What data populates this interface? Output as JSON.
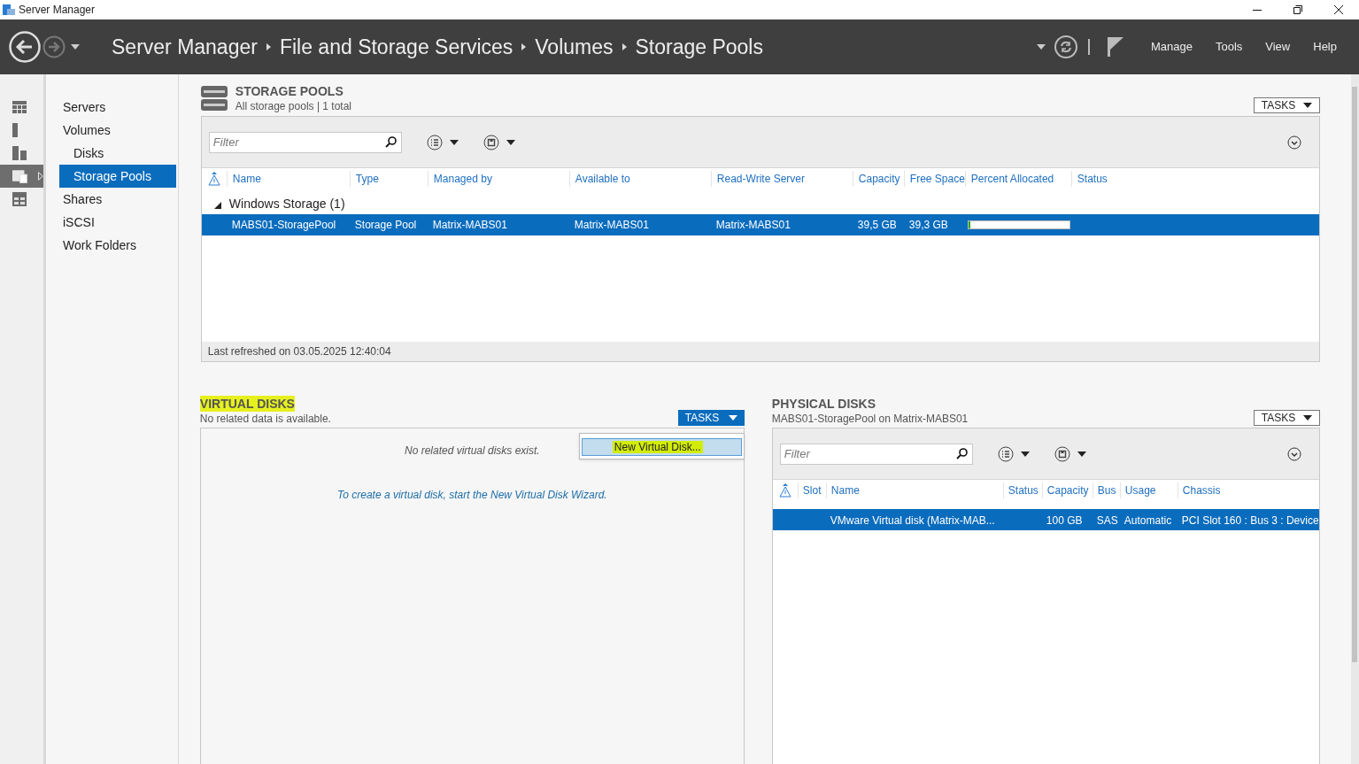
{
  "window": {
    "title": "Server Manager"
  },
  "breadcrumb": [
    "Server Manager",
    "File and Storage Services",
    "Volumes",
    "Storage Pools"
  ],
  "menu": [
    "Manage",
    "Tools",
    "View",
    "Help"
  ],
  "rail": [
    {
      "kind": "dashboard",
      "selected": false
    },
    {
      "kind": "server",
      "selected": false
    },
    {
      "kind": "servers",
      "selected": false
    },
    {
      "kind": "storage",
      "selected": true
    },
    {
      "kind": "roles",
      "selected": false
    }
  ],
  "nav": [
    {
      "label": "Servers",
      "selected": false
    },
    {
      "label": "Volumes",
      "selected": false,
      "children": [
        {
          "label": "Disks",
          "selected": false
        },
        {
          "label": "Storage Pools",
          "selected": true
        }
      ]
    },
    {
      "label": "Shares",
      "selected": false
    },
    {
      "label": "iSCSI",
      "selected": false
    },
    {
      "label": "Work Folders",
      "selected": false
    }
  ],
  "storage_pools": {
    "title": "STORAGE POOLS",
    "subtitle": "All storage pools | 1 total",
    "tasks": "TASKS",
    "filter": {
      "placeholder": "Filter"
    },
    "columns": [
      "Name",
      "Type",
      "Managed by",
      "Available to",
      "Read-Write Server",
      "Capacity",
      "Free Space",
      "Percent Allocated",
      "Status"
    ],
    "group": {
      "label": "Windows Storage (1)",
      "expanded": true
    },
    "rows": [
      {
        "selected": true,
        "cells": [
          "MABS01-StoragePool",
          "Storage Pool",
          "Matrix-MABS01",
          "Matrix-MABS01",
          "Matrix-MABS01",
          "39,5 GB",
          "39,3 GB"
        ],
        "level": 0.01
      }
    ],
    "footer": "Last refreshed on 03.05.2025 12:40:04"
  },
  "virtual_disks": {
    "title": "VIRTUAL DISKS",
    "highlighted": true,
    "subtitle": "No related data is available.",
    "tasks": "TASKS",
    "tasks_open": true,
    "menu": [
      {
        "label": "New Virtual Disk...",
        "selected": true,
        "highlighted": true
      }
    ],
    "empty": "No related virtual disks exist.",
    "hint": "To create a virtual disk, start the New Virtual Disk Wizard."
  },
  "physical_disks": {
    "title": "PHYSICAL DISKS",
    "subtitle": "MABS01-StoragePool on Matrix-MABS01",
    "tasks": "TASKS",
    "filter": {
      "placeholder": "Filter"
    },
    "columns": [
      "Slot",
      "Name",
      "Status",
      "Capacity",
      "Bus",
      "Usage",
      "Chassis"
    ],
    "rows": [
      {
        "selected": true,
        "cells": [
          null,
          "VMware Virtual disk (Matrix-MAB...",
          null,
          "100 GB",
          "SAS",
          "Automatic",
          "PCI Slot 160 : Bus 3 : Device"
        ]
      }
    ]
  }
}
